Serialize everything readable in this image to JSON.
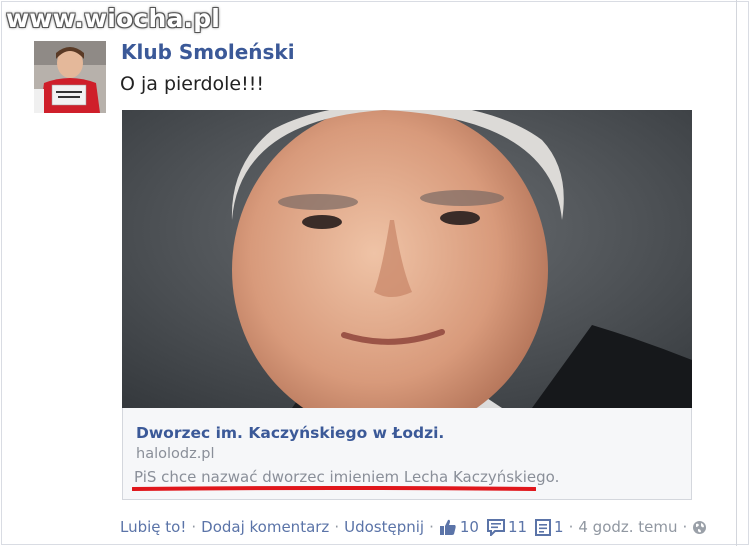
{
  "watermark": {
    "text": "www.wiocha.pl"
  },
  "post": {
    "author": "Klub Smoleński",
    "message": "O ja pierdole!!!"
  },
  "link_preview": {
    "title": "Dworzec im. Kaczyńskiego w Łodzi.",
    "domain": "halolodz.pl",
    "description": "PiS chce nazwać dworzec imieniem Lecha Kaczyńskiego."
  },
  "actions": {
    "like": "Lubię to!",
    "comment": "Dodaj komentarz",
    "share": "Udostępnij",
    "separator": "·",
    "likes_count": "10",
    "comments_count": "11",
    "shares_count": "1",
    "time": "4 godz. temu"
  },
  "colors": {
    "link_blue": "#3b5998",
    "highlight_red": "#e0161b",
    "muted_gray": "#8a8f99"
  },
  "icons": [
    "thumbs-up-icon",
    "comment-icon",
    "share-doc-icon",
    "globe-icon"
  ]
}
